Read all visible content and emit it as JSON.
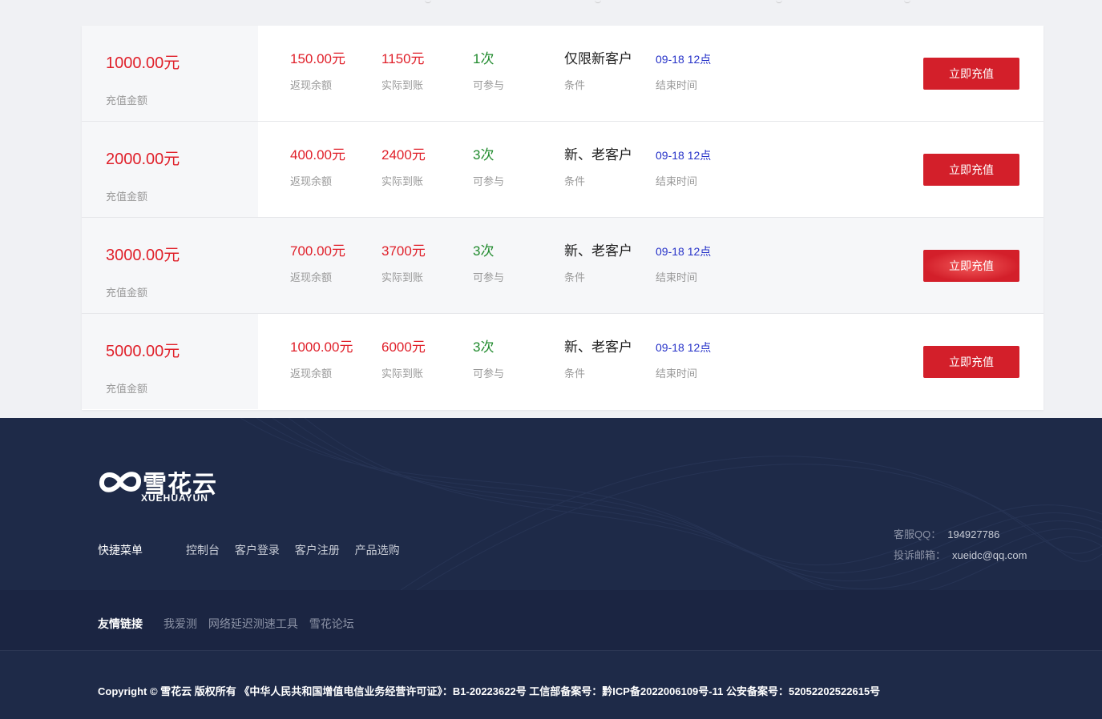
{
  "recharge_rows": [
    {
      "amount": "1000.00元",
      "amount_label": "充值金额",
      "cashback": "150.00元",
      "cashback_label": "返现余额",
      "actual": "1150元",
      "actual_label": "实际到账",
      "times": "1次",
      "times_label": "可参与",
      "condition": "仅限新客户",
      "condition_label": "条件",
      "end_time": "09-18 12点",
      "end_label": "结束时间",
      "button": "立即充值"
    },
    {
      "amount": "2000.00元",
      "amount_label": "充值金额",
      "cashback": "400.00元",
      "cashback_label": "返现余额",
      "actual": "2400元",
      "actual_label": "实际到账",
      "times": "3次",
      "times_label": "可参与",
      "condition": "新、老客户",
      "condition_label": "条件",
      "end_time": "09-18 12点",
      "end_label": "结束时间",
      "button": "立即充值"
    },
    {
      "amount": "3000.00元",
      "amount_label": "充值金额",
      "cashback": "700.00元",
      "cashback_label": "返现余额",
      "actual": "3700元",
      "actual_label": "实际到账",
      "times": "3次",
      "times_label": "可参与",
      "condition": "新、老客户",
      "condition_label": "条件",
      "end_time": "09-18 12点",
      "end_label": "结束时间",
      "button": "立即充值"
    },
    {
      "amount": "5000.00元",
      "amount_label": "充值金额",
      "cashback": "1000.00元",
      "cashback_label": "返现余额",
      "actual": "6000元",
      "actual_label": "实际到账",
      "times": "3次",
      "times_label": "可参与",
      "condition": "新、老客户",
      "condition_label": "条件",
      "end_time": "09-18 12点",
      "end_label": "结束时间",
      "button": "立即充值"
    }
  ],
  "colors": {
    "accent_red": "#d31f2a",
    "amount_red": "#e0202a",
    "green": "#1f8a2c",
    "blue": "#2430c8",
    "footer_bg": "#1e2a48"
  },
  "footer": {
    "logo_cn": "雪花云",
    "logo_en": "XUEHUAYUN",
    "quick_menu_title": "快捷菜单",
    "quick_links": [
      "控制台",
      "客户登录",
      "客户注册",
      "产品选购"
    ],
    "contact": {
      "qq_label": "客服QQ：",
      "qq": "194927786",
      "email_label": "投诉邮箱：",
      "email": "xueidc@qq.com"
    },
    "friend_links_title": "友情链接",
    "friend_links": [
      "我爱测",
      "网络延迟测速工具",
      "雪花论坛"
    ],
    "copyright": "Copyright © 雪花云 版权所有 《中华人民共和国增值电信业务经营许可证》：B1-20223622号 工信部备案号：黔ICP备2022006109号-11 公安备案号：52052202522615号"
  }
}
